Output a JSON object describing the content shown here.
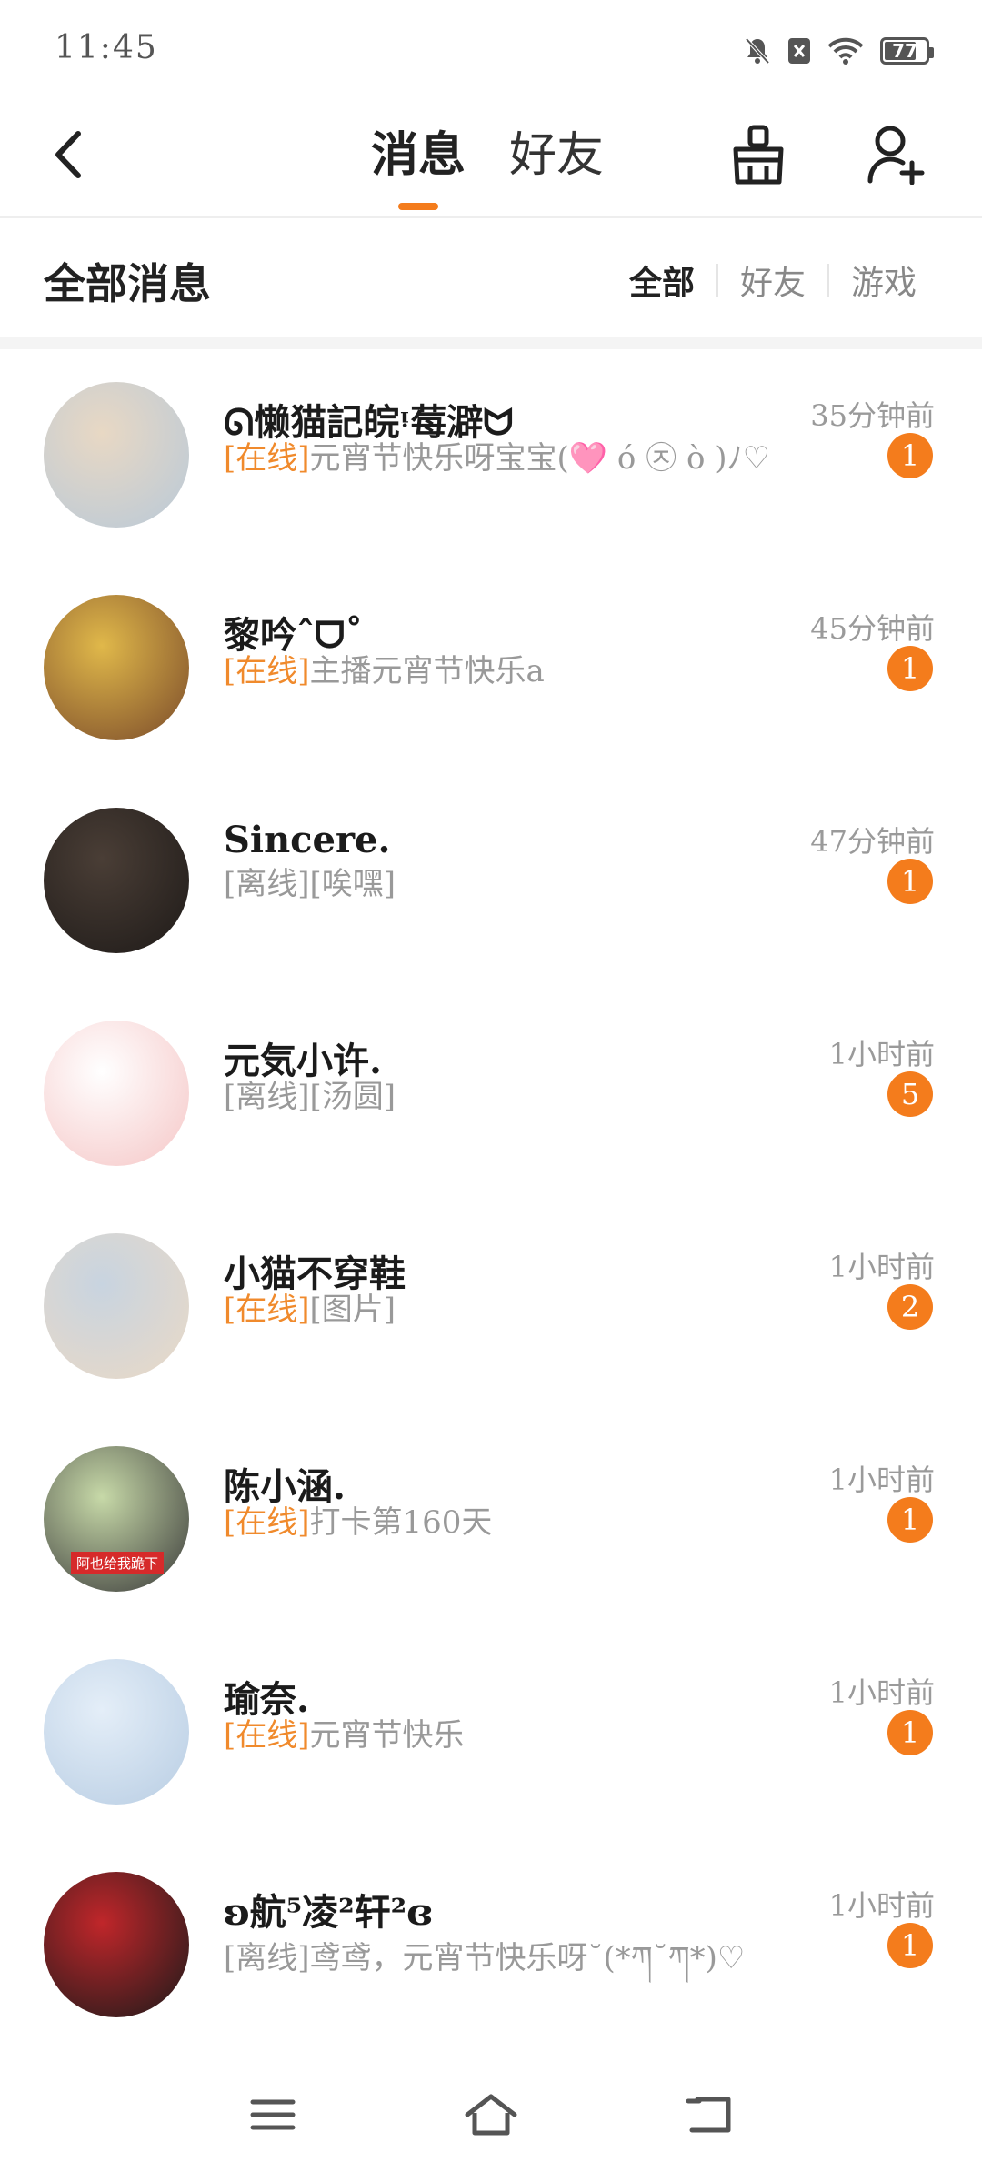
{
  "status": {
    "time": "11:45",
    "battery": "77",
    "battery_level": 0.77
  },
  "header": {
    "tabs": [
      {
        "label": "消息",
        "active": true
      },
      {
        "label": "好友",
        "active": false
      }
    ]
  },
  "filter_bar": {
    "title": "全部消息",
    "filters": [
      {
        "label": "全部",
        "active": true
      },
      {
        "label": "好友",
        "active": false
      },
      {
        "label": "游戏",
        "active": false
      }
    ]
  },
  "messages": [
    {
      "name": "ᘏ懒猫記皖ᵎ莓澼ᗢ",
      "status": "[在线]",
      "status_type": "online",
      "text": "元宵节快乐呀宝宝(🩷 ó ㉨ ò )ﾉ♡",
      "time": "35分钟前",
      "badge": "1",
      "avatar_colors": [
        "#e8d8c4",
        "#b9c9d8"
      ]
    },
    {
      "name": "黎吟ˆᗜ˚",
      "status": "[在线]",
      "status_type": "online",
      "text": "主播元宵节快乐a",
      "time": "45分钟前",
      "badge": "1",
      "avatar_colors": [
        "#e0b84a",
        "#7a4a2a"
      ]
    },
    {
      "name": "Sincere.",
      "status": "[离线]",
      "status_type": "offline",
      "text": "[唉嘿]",
      "time": "47分钟前",
      "badge": "1",
      "avatar_colors": [
        "#4a3e36",
        "#1e1a18"
      ]
    },
    {
      "name": "元気小许.",
      "status": "[离线]",
      "status_type": "offline",
      "text": "[汤圆]",
      "time": "1小时前",
      "badge": "5",
      "avatar_colors": [
        "#ffffff",
        "#f5c6c6"
      ]
    },
    {
      "name": "小猫不穿鞋",
      "status": "[在线]",
      "status_type": "online",
      "text": "[图片]",
      "time": "1小时前",
      "badge": "2",
      "avatar_colors": [
        "#c8d4e0",
        "#ead9c6"
      ]
    },
    {
      "name": "陈小涵.",
      "status": "[在线]",
      "status_type": "online",
      "text": "打卡第160天",
      "time": "1小时前",
      "badge": "1",
      "avatar_colors": [
        "#c7d9a8",
        "#3a3a3a"
      ],
      "avatar_caption": "阿也给我跪下"
    },
    {
      "name": "瑜奈.",
      "status": "[在线]",
      "status_type": "online",
      "text": "元宵节快乐",
      "time": "1小时前",
      "badge": "1",
      "avatar_colors": [
        "#e4eef8",
        "#b8cde3"
      ]
    },
    {
      "name": "ʚ航⁵凌²轩²ɞ",
      "status": "[离线]",
      "status_type": "offline",
      "text": "鸢鸢，元宵节快乐呀˘(*ཀ˘ཀ*)♡",
      "time": "1小时前",
      "badge": "1",
      "avatar_colors": [
        "#c0262a",
        "#1a1a1a"
      ]
    }
  ],
  "nav": {
    "icons": [
      "menu-icon",
      "home-icon",
      "back-icon"
    ]
  }
}
